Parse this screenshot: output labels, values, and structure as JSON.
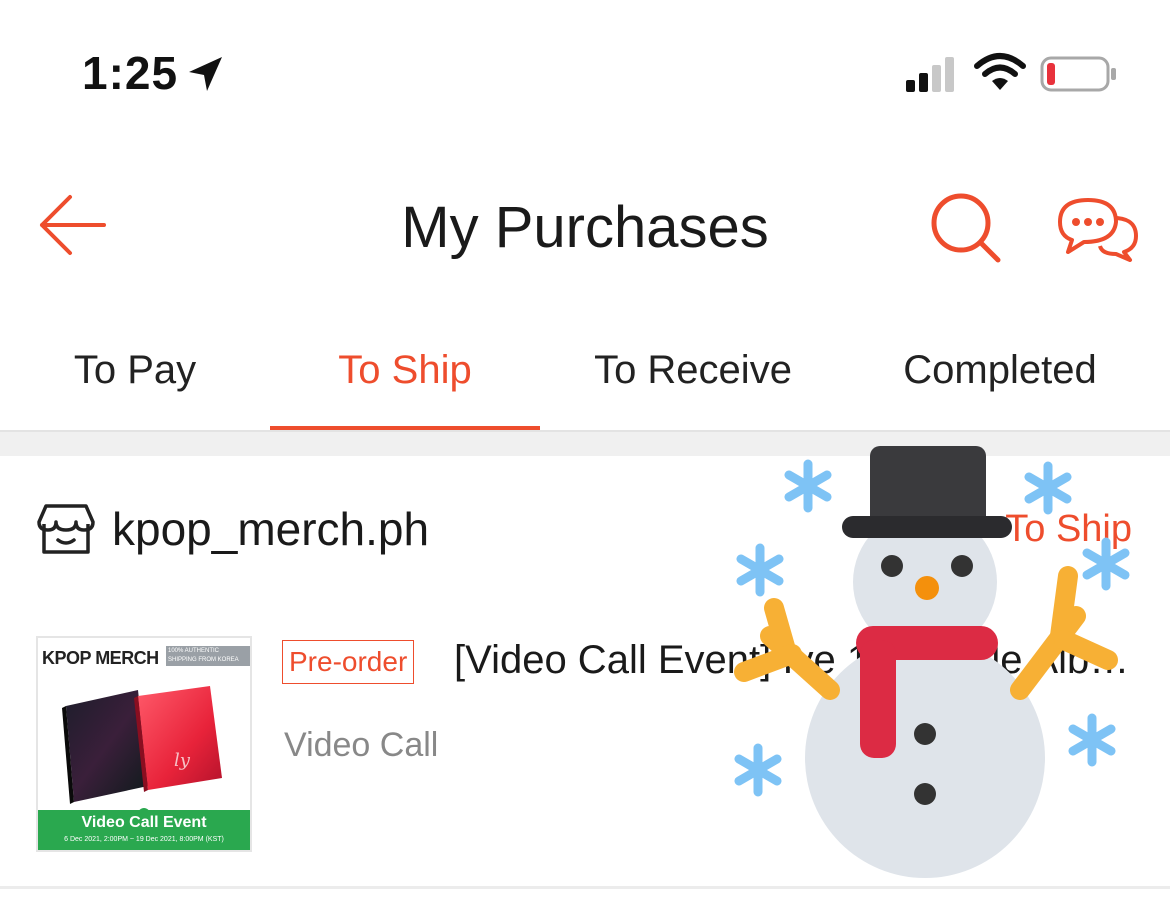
{
  "status_bar": {
    "time": "1:25",
    "icons": [
      "location-arrow-icon",
      "cellular-signal-icon",
      "wifi-icon",
      "battery-low-icon"
    ]
  },
  "header": {
    "title": "My Purchases",
    "icons": [
      "back-arrow-icon",
      "search-icon",
      "chat-icon"
    ],
    "accent_color": "#ee4d2d"
  },
  "tabs": [
    {
      "label": "To Pay",
      "active": false
    },
    {
      "label": "To Ship",
      "active": true
    },
    {
      "label": "To Receive",
      "active": false
    },
    {
      "label": "Completed",
      "active": false
    }
  ],
  "order": {
    "shop_name": "kpop_merch.ph",
    "status": "To Ship",
    "badge": "Pre-order",
    "product_title": "[Video Call Event] Ive 1st Single Album",
    "variation": "Video Call",
    "thumbnail": {
      "brand": "KPOP MERCH",
      "tagline": "100% AUTHENTIC SHIPPING FROM KOREA",
      "banner_title": "Video Call Event",
      "banner_date": "6 Dec 2021, 2:00PM ~ 19 Dec 2021, 8:00PM (KST)"
    }
  },
  "sticker": {
    "icon": "snowman-icon",
    "decor": "snowflake-icon"
  }
}
